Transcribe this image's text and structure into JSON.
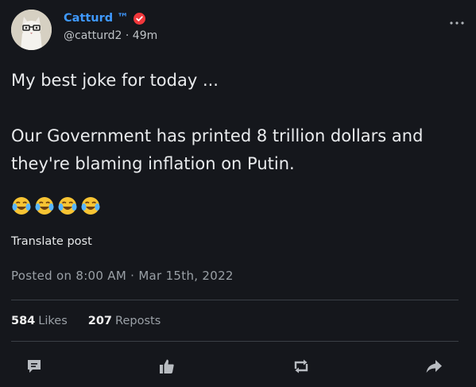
{
  "author": {
    "name": "Catturd ™",
    "handle": "@catturd2",
    "time": "· 49m",
    "avatar_icon": "cat-with-glasses-avatar"
  },
  "menu": {
    "icon": "more-options-icon"
  },
  "post": {
    "line1": "My best joke for today ...",
    "line2": "Our Government has printed 8 trillion dollars and they're blaming inflation on Putin.",
    "emojis": [
      "😂",
      "😂",
      "😂",
      "😂"
    ]
  },
  "translate_label": "Translate post",
  "posted": "Posted on 8:00 AM · Mar 15th, 2022",
  "stats": {
    "likes_count": "584",
    "likes_label": "Likes",
    "reposts_count": "207",
    "reposts_label": "Reposts"
  },
  "actions": [
    "comment-icon",
    "like-icon",
    "repost-icon",
    "share-icon"
  ],
  "colors": {
    "background": "#15171c",
    "name": "#3f99ff",
    "verified": "#f0373b",
    "muted": "#9aa0a6",
    "divider": "#3a3f46"
  }
}
